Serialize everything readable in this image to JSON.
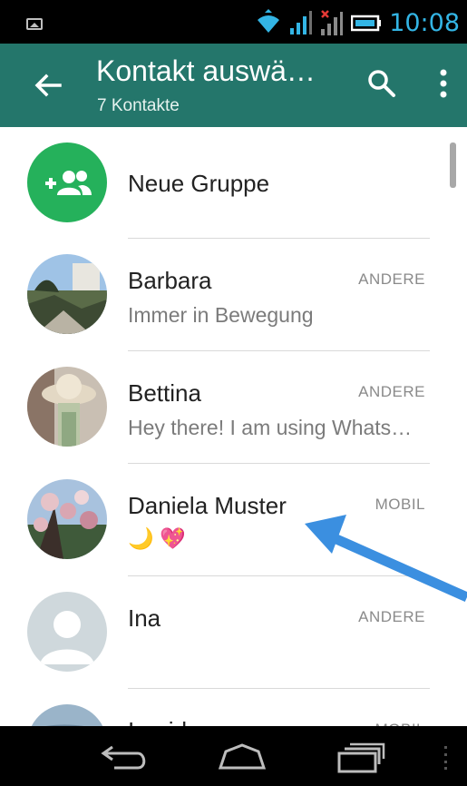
{
  "status_bar": {
    "time": "10:08"
  },
  "app_bar": {
    "title": "Kontakt auswä…",
    "subtitle": "7 Kontakte"
  },
  "new_group": {
    "label": "Neue Gruppe",
    "icon": "add-group-icon",
    "color": "#25b15b"
  },
  "contacts": [
    {
      "name": "Barbara",
      "status": "Immer in Bewegung",
      "type": "ANDERE"
    },
    {
      "name": "Bettina",
      "status": "Hey there! I am using Whats…",
      "type": "ANDERE"
    },
    {
      "name": "Daniela Muster",
      "status": "🌙 💖",
      "type": "MOBIL"
    },
    {
      "name": "Ina",
      "status": "",
      "type": "ANDERE"
    },
    {
      "name": "Ingrid",
      "status": "",
      "type": "MOBIL"
    }
  ],
  "colors": {
    "app_bar": "#24766b",
    "accent_time": "#33b5e5",
    "annotation_arrow": "#3b8fe0"
  }
}
